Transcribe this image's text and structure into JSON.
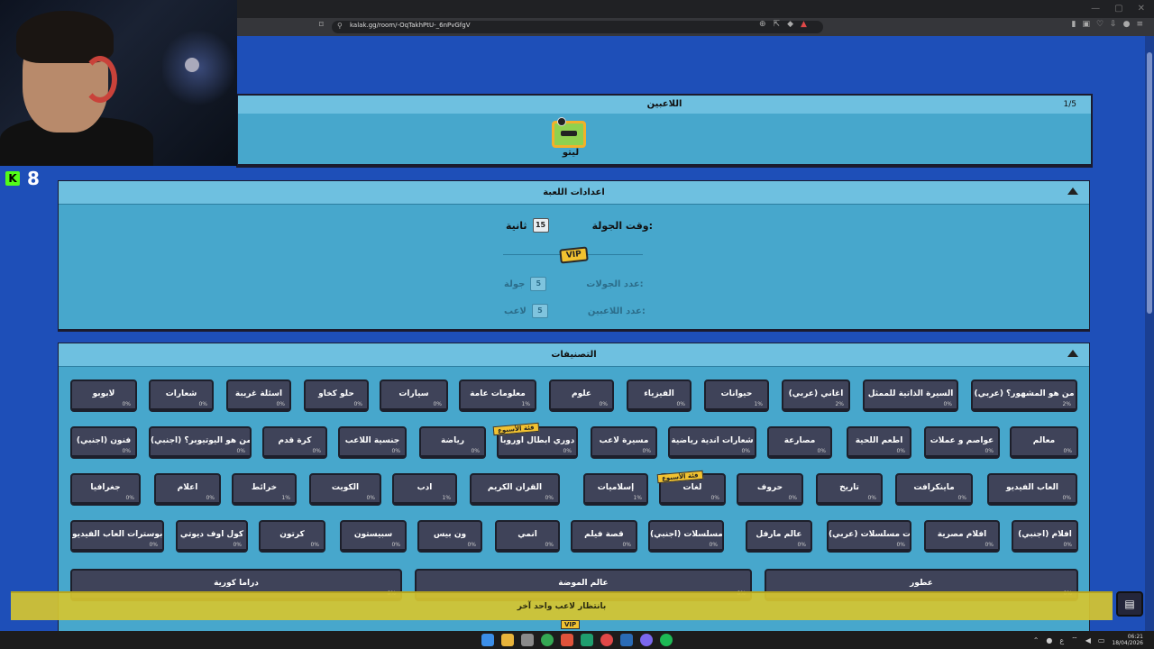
{
  "browser": {
    "url": "kalak.gg/room/-OqTakhPtU-_6nPvGfgV",
    "window_controls": [
      "—",
      "▢",
      "✕"
    ]
  },
  "stream": {
    "viewer_count": "8",
    "platform_logo": "K"
  },
  "players": {
    "title": "اللاعبين",
    "count": "1/5",
    "player_name": "ليتو"
  },
  "settings": {
    "title": "اعدادات اللعبة",
    "round_time_label": "وقت الجولة:",
    "round_time_value": "15",
    "round_time_unit": "ثانية",
    "vip_label": "VIP",
    "rounds_label": "عدد الجولات:",
    "rounds_value": "5",
    "rounds_unit": "جولة",
    "players_label": "عدد اللاعبين:",
    "players_value": "5",
    "players_unit": "لاعب"
  },
  "categories": {
    "title": "التصنيفات",
    "week_tag": "فئة الأسبوع",
    "items": [
      {
        "label": "من هو المشهور؟ (عربي)",
        "pct": "2%"
      },
      {
        "label": "السيرة الذاتية للممثل",
        "pct": "0%"
      },
      {
        "label": "أغاني (عربي)",
        "pct": "2%"
      },
      {
        "label": "حيوانات",
        "pct": "1%"
      },
      {
        "label": "الفيزياء",
        "pct": "0%"
      },
      {
        "label": "علوم",
        "pct": "0%"
      },
      {
        "label": "معلومات عامة",
        "pct": "1%"
      },
      {
        "label": "سيارات",
        "pct": "0%"
      },
      {
        "label": "حلو كخاو",
        "pct": "0%"
      },
      {
        "label": "أسئلة غريبة",
        "pct": "0%"
      },
      {
        "label": "شعارات",
        "pct": "0%"
      },
      {
        "label": "لابوبو",
        "pct": "0%"
      },
      {
        "label": "معالم",
        "pct": "0%"
      },
      {
        "label": "عواصم و عملات",
        "pct": "0%"
      },
      {
        "label": "أطعم اللحية",
        "pct": "0%"
      },
      {
        "label": "مصارعة",
        "pct": "0%"
      },
      {
        "label": "شعارات أندية رياضية",
        "pct": "0%"
      },
      {
        "label": "مسيرة لاعب",
        "pct": "0%"
      },
      {
        "label": "دوري أبطال أوروبا",
        "pct": "0%"
      },
      {
        "label": "رياضة",
        "pct": "0%"
      },
      {
        "label": "جنسية اللاعب",
        "pct": "0%"
      },
      {
        "label": "كرة قدم",
        "pct": "0%"
      },
      {
        "label": "من هو اليوتيوبر؟ (أجنبي)",
        "pct": "0%"
      },
      {
        "label": "فنون (أجنبي)",
        "pct": "0%"
      },
      {
        "label": "ألعاب الفيديو",
        "pct": "0%"
      },
      {
        "label": "ماينكرافت",
        "pct": "0%"
      },
      {
        "label": "تاريخ",
        "pct": "0%"
      },
      {
        "label": "حروف",
        "pct": "0%"
      },
      {
        "label": "لغات",
        "pct": "0%"
      },
      {
        "label": "إسلاميات",
        "pct": "1%"
      },
      {
        "label": "القرآن الكريم",
        "pct": "0%"
      },
      {
        "label": "أدب",
        "pct": "1%"
      },
      {
        "label": "الكويت",
        "pct": "0%"
      },
      {
        "label": "خرائط",
        "pct": "1%"
      },
      {
        "label": "أعلام",
        "pct": "0%"
      },
      {
        "label": "جغرافيا",
        "pct": "0%"
      },
      {
        "label": "أفلام (أجنبي)",
        "pct": "0%"
      },
      {
        "label": "أفلام مصرية",
        "pct": "0%"
      },
      {
        "label": "بوسترات مسلسلات (عربي)",
        "pct": "0%"
      },
      {
        "label": "عالم مارفل",
        "pct": "0%"
      },
      {
        "label": "مسلسلات (أجنبي)",
        "pct": "0%"
      },
      {
        "label": "قصة فيلم",
        "pct": "0%"
      },
      {
        "label": "أنمي",
        "pct": "0%"
      },
      {
        "label": "ون بيس",
        "pct": "0%"
      },
      {
        "label": "سبيستون",
        "pct": "0%"
      },
      {
        "label": "كرتون",
        "pct": "0%"
      },
      {
        "label": "كول اوف ديوتي",
        "pct": "0%"
      },
      {
        "label": "بوسترات ألعاب الفيديو",
        "pct": "0%"
      },
      {
        "label": "عطور",
        "pct": "0%"
      },
      {
        "label": "عالم الموضة",
        "pct": "0%"
      },
      {
        "label": "دراما كورية",
        "pct": "0%"
      }
    ]
  },
  "waiting": {
    "text": "بانتظار لاعب واحد آخر"
  },
  "taskbar": {
    "time": "06:21",
    "date": "18/04/2026",
    "lang": "ع"
  },
  "colors": {
    "page_bg": "#1e4fb8",
    "panel_bg": "#47a7cc",
    "button_bg": "#3f4359",
    "vip_yellow": "#f2c230",
    "banner_yellow": "#d6c630"
  }
}
